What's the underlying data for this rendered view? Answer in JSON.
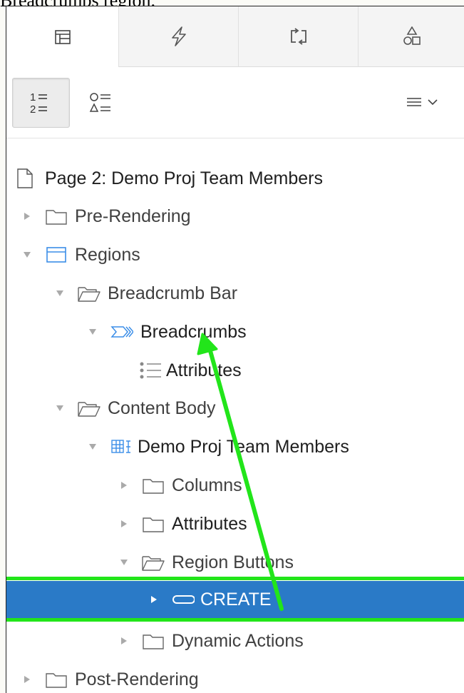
{
  "caption": "Breadcrumbs region.",
  "tabs": [
    {
      "name": "rendering",
      "icon": "rendering-tree-icon",
      "active": true
    },
    {
      "name": "dynamic-actions",
      "icon": "lightning-icon",
      "active": false
    },
    {
      "name": "processing",
      "icon": "processing-arrows-icon",
      "active": false
    },
    {
      "name": "shared-components",
      "icon": "shapes-icon",
      "active": false
    }
  ],
  "toolbar": {
    "group_by_component_type": {
      "icon": "numbered-list-icon",
      "pressed": true,
      "label": "1=\n2="
    },
    "group_by_processing_order": {
      "icon": "shape-list-icon",
      "pressed": false
    },
    "menu": {
      "icon": "hamburger-menu-icon"
    }
  },
  "tree": [
    {
      "label": "Page 2: Demo Proj Team Members",
      "icon": "page-icon",
      "toggle": "none"
    },
    {
      "label": "Pre-Rendering",
      "icon": "folder-icon",
      "toggle": "collapsed"
    },
    {
      "label": "Regions",
      "icon": "region-icon",
      "toggle": "expanded"
    },
    {
      "label": "Breadcrumb Bar",
      "icon": "folder-open-icon",
      "toggle": "expanded"
    },
    {
      "label": "Breadcrumbs",
      "icon": "breadcrumb-icon",
      "toggle": "expanded"
    },
    {
      "label": "Attributes",
      "icon": "attributes-icon",
      "toggle": "none"
    },
    {
      "label": "Content Body",
      "icon": "folder-open-icon",
      "toggle": "expanded"
    },
    {
      "label": "Demo Proj Team Members",
      "icon": "report-icon",
      "toggle": "expanded"
    },
    {
      "label": "Columns",
      "icon": "folder-icon",
      "toggle": "collapsed"
    },
    {
      "label": "Attributes",
      "icon": "folder-icon",
      "toggle": "collapsed"
    },
    {
      "label": "Region Buttons",
      "icon": "folder-open-icon",
      "toggle": "expanded"
    },
    {
      "label": "CREATE",
      "icon": "button-icon",
      "toggle": "collapsed",
      "selected": true
    },
    {
      "label": "Dynamic Actions",
      "icon": "folder-icon",
      "toggle": "collapsed"
    },
    {
      "label": "Post-Rendering",
      "icon": "folder-icon",
      "toggle": "collapsed"
    }
  ],
  "colors": {
    "selected_row": "#2a7ac7",
    "annotation": "#22e51a",
    "region_icon": "#3b8ee8"
  }
}
